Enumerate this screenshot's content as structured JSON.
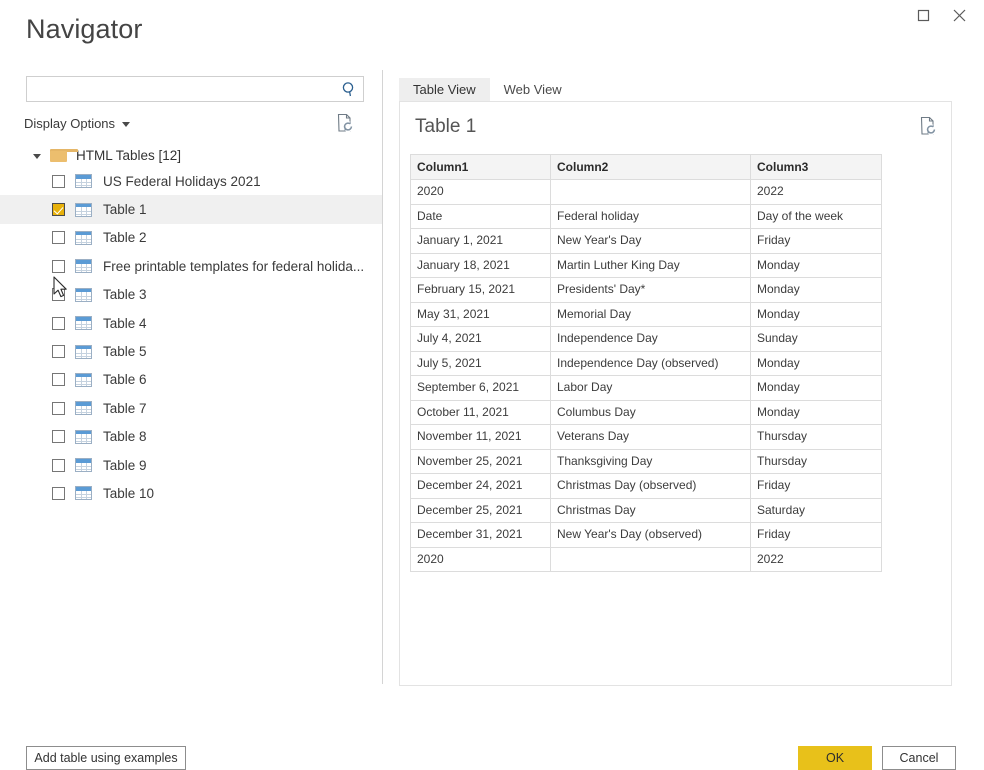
{
  "window": {
    "title": "Navigator",
    "maximize_icon": "maximize-icon",
    "close_icon": "close-icon"
  },
  "left_pane": {
    "search": {
      "value": "",
      "placeholder": "",
      "icon": "search-icon"
    },
    "display_options": {
      "label": "Display Options",
      "caret_icon": "chevron-down-icon"
    },
    "refresh_icon": "refresh-preview-icon",
    "tree": {
      "root": {
        "label": "HTML Tables [12]",
        "expander_icon": "triangle-down-icon",
        "folder_icon": "folder-icon",
        "expanded": true
      },
      "items": [
        {
          "label": "US Federal Holidays 2021",
          "checked": false,
          "selected": false
        },
        {
          "label": "Table 1",
          "checked": true,
          "selected": true
        },
        {
          "label": "Table 2",
          "checked": false,
          "selected": false
        },
        {
          "label": "Free printable templates for federal holida...",
          "checked": false,
          "selected": false
        },
        {
          "label": "Table 3",
          "checked": false,
          "selected": false
        },
        {
          "label": "Table 4",
          "checked": false,
          "selected": false
        },
        {
          "label": "Table 5",
          "checked": false,
          "selected": false
        },
        {
          "label": "Table 6",
          "checked": false,
          "selected": false
        },
        {
          "label": "Table 7",
          "checked": false,
          "selected": false
        },
        {
          "label": "Table 8",
          "checked": false,
          "selected": false
        },
        {
          "label": "Table 9",
          "checked": false,
          "selected": false
        },
        {
          "label": "Table 10",
          "checked": false,
          "selected": false
        }
      ]
    }
  },
  "right_pane": {
    "tabs": [
      {
        "label": "Table View",
        "active": true
      },
      {
        "label": "Web View",
        "active": false
      }
    ],
    "preview_title": "Table 1",
    "refresh_icon": "refresh-preview-icon",
    "table": {
      "headers": [
        "Column1",
        "Column2",
        "Column3"
      ],
      "rows": [
        [
          "2020",
          "",
          "2022"
        ],
        [
          "Date",
          "Federal holiday",
          "Day of the week"
        ],
        [
          "January 1, 2021",
          "New Year's Day",
          "Friday"
        ],
        [
          "January 18, 2021",
          "Martin Luther King Day",
          "Monday"
        ],
        [
          "February 15, 2021",
          "Presidents' Day*",
          "Monday"
        ],
        [
          "May 31, 2021",
          "Memorial Day",
          "Monday"
        ],
        [
          "July 4, 2021",
          "Independence Day",
          "Sunday"
        ],
        [
          "July 5, 2021",
          "Independence Day (observed)",
          "Monday"
        ],
        [
          "September 6, 2021",
          "Labor Day",
          "Monday"
        ],
        [
          "October 11, 2021",
          "Columbus Day",
          "Monday"
        ],
        [
          "November 11, 2021",
          "Veterans Day",
          "Thursday"
        ],
        [
          "November 25, 2021",
          "Thanksgiving Day",
          "Thursday"
        ],
        [
          "December 24, 2021",
          "Christmas Day (observed)",
          "Friday"
        ],
        [
          "December 25, 2021",
          "Christmas Day",
          "Saturday"
        ],
        [
          "December 31, 2021",
          "New Year's Day (observed)",
          "Friday"
        ],
        [
          "2020",
          "",
          "2022"
        ]
      ]
    }
  },
  "footer": {
    "add_table_label": "Add table using examples",
    "ok_label": "OK",
    "cancel_label": "Cancel"
  },
  "colors": {
    "accent_gold": "#e8c11a",
    "checkbox_gold": "#e8b10a",
    "folder_orange": "#ecbe6e",
    "table_icon_blue": "#5b9bd5",
    "header_bg": "#f4f4f4",
    "selected_row": "#f0f0f0"
  }
}
